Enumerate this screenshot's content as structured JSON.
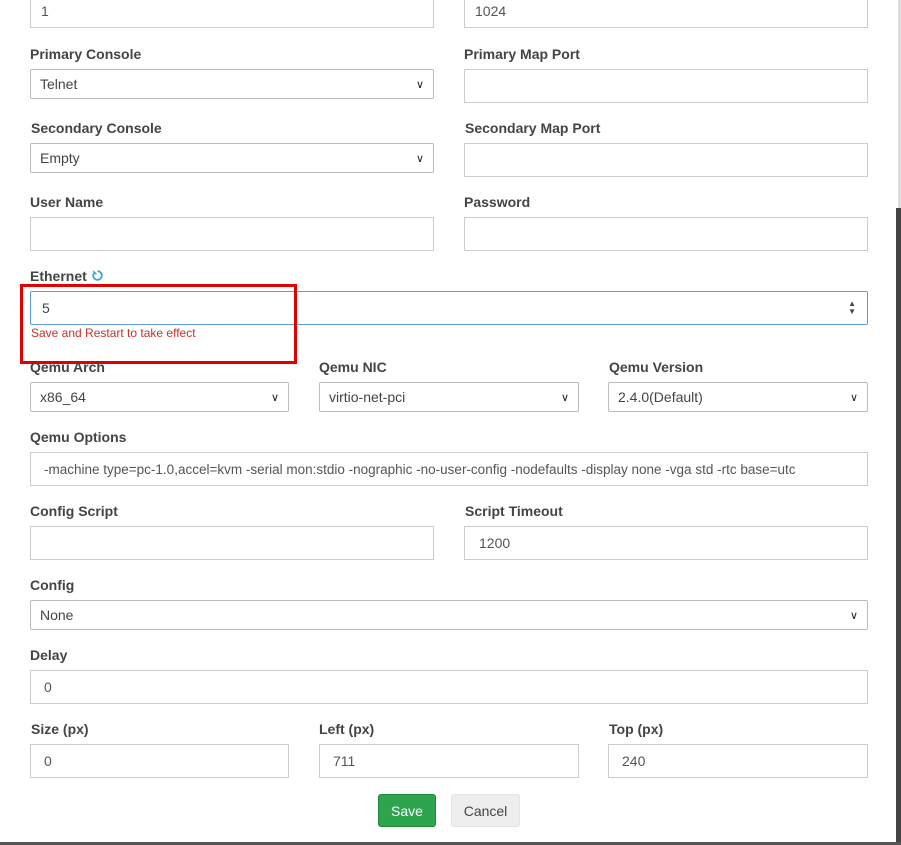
{
  "top_row": {
    "left_value": "1",
    "right_value": "1024"
  },
  "primary_console": {
    "label": "Primary Console",
    "value": "Telnet"
  },
  "primary_map_port": {
    "label": "Primary Map Port",
    "value": ""
  },
  "secondary_console": {
    "label": "Secondary Console",
    "value": "Empty"
  },
  "secondary_map_port": {
    "label": "Secondary Map Port",
    "value": ""
  },
  "user_name": {
    "label": "User Name",
    "value": ""
  },
  "password": {
    "label": "Password",
    "value": ""
  },
  "ethernet": {
    "label": "Ethernet",
    "value": "5",
    "error": "Save and Restart to take effect"
  },
  "qemu_arch": {
    "label": "Qemu Arch",
    "value": "x86_64"
  },
  "qemu_nic": {
    "label": "Qemu NIC",
    "value": "virtio-net-pci"
  },
  "qemu_version": {
    "label": "Qemu Version",
    "value": "2.4.0(Default)"
  },
  "qemu_options": {
    "label": "Qemu Options",
    "value": "-machine type=pc-1.0,accel=kvm -serial mon:stdio -nographic -no-user-config -nodefaults -display none -vga std -rtc base=utc"
  },
  "config_script": {
    "label": "Config Script",
    "value": ""
  },
  "script_timeout": {
    "label": "Script Timeout",
    "value": "1200"
  },
  "config": {
    "label": "Config",
    "value": "None"
  },
  "delay": {
    "label": "Delay",
    "value": "0"
  },
  "size": {
    "label": "Size (px)",
    "value": "0"
  },
  "left": {
    "label": "Left (px)",
    "value": "711"
  },
  "top": {
    "label": "Top (px)",
    "value": "240"
  },
  "buttons": {
    "save": "Save",
    "cancel": "Cancel"
  },
  "colors": {
    "save_bg": "#2ea44f",
    "error_text": "#c9302c",
    "highlight_border": "#e00000",
    "focus_border": "#5b9bd5"
  }
}
